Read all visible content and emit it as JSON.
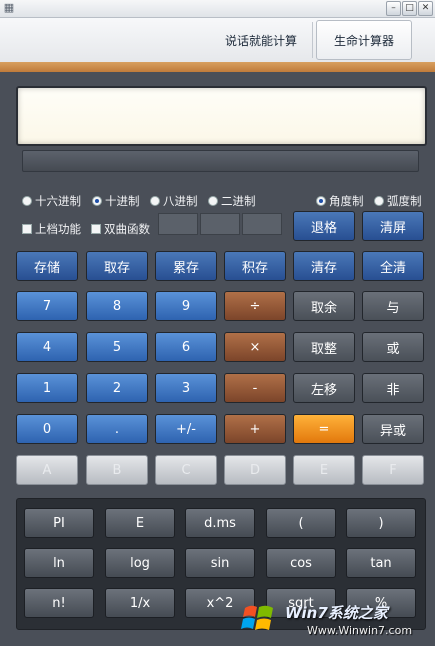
{
  "window": {
    "app_icon": "calculator-icon",
    "controls": [
      "minimize-icon",
      "maximize-icon",
      "close-icon"
    ]
  },
  "topbar": {
    "voice_calc": "说话就能计算",
    "life_calc": "生命计算器"
  },
  "display": {
    "value": ""
  },
  "base_options": {
    "hex": "十六进制",
    "dec": "十进制",
    "oct": "八进制",
    "bin": "二进制",
    "selected": "dec"
  },
  "angle_options": {
    "degree": "角度制",
    "radian": "弧度制",
    "selected": "degree"
  },
  "checks": {
    "shift": "上档功能",
    "hyperbolic": "双曲函数"
  },
  "edit_buttons": {
    "backspace": "退格",
    "clear_screen": "清屏"
  },
  "memory_buttons": {
    "store": "存储",
    "recall": "取存",
    "add": "累存",
    "mul": "积存",
    "clear": "清存",
    "all_clear": "全清"
  },
  "keys": {
    "r1": [
      "7",
      "8",
      "9",
      "÷",
      "取余",
      "与"
    ],
    "r2": [
      "4",
      "5",
      "6",
      "×",
      "取整",
      "或"
    ],
    "r3": [
      "1",
      "2",
      "3",
      "-",
      "左移",
      "非"
    ],
    "r4": [
      "0",
      ".",
      "+/-",
      "+",
      "=",
      "异或"
    ],
    "hex": [
      "A",
      "B",
      "C",
      "D",
      "E",
      "F"
    ]
  },
  "sci_keys": {
    "r1": [
      "PI",
      "E",
      "d.ms",
      "(",
      ")"
    ],
    "r2": [
      "ln",
      "log",
      "sin",
      "cos",
      "tan"
    ],
    "r3": [
      "n!",
      "1/x",
      "x^2",
      "sqrt",
      "%"
    ]
  },
  "watermark": {
    "title": "Win7系统之家",
    "url": "Www.Winwin7.com"
  },
  "colors": {
    "blue": "#2e63b0",
    "brown": "#7c452a",
    "orange": "#e2780c",
    "panel": "#4a4f58"
  }
}
